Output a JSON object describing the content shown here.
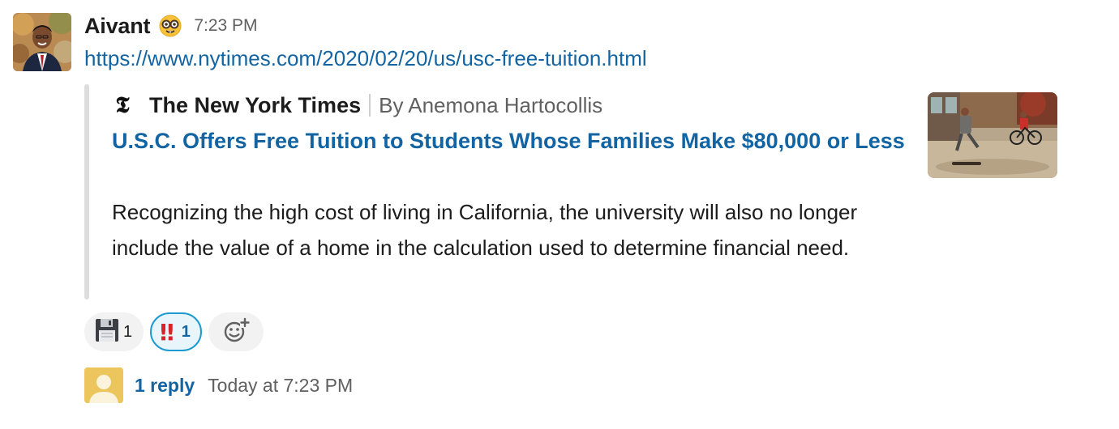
{
  "message": {
    "author": "Aivant",
    "status_emoji": "nerd-face-icon",
    "timestamp": "7:23 PM",
    "link_text": "https://www.nytimes.com/2020/02/20/us/usc-free-tuition.html"
  },
  "attachment": {
    "source_name": "The New York Times",
    "byline": "By Anemona Hartocollis",
    "title": "U.S.C. Offers Free Tuition to Students Whose Families Make $80,000 or Less",
    "description": "Recognizing the high cost of living in California, the university will also no longer include the value of a home in the calculation used to determine financial need.",
    "logo_icon": "nyt-logo-icon",
    "logo_glyph": "𝕿"
  },
  "reactions": [
    {
      "icon": "floppy-disk-icon",
      "count": "1",
      "active": false
    },
    {
      "icon": "double-exclamation-icon",
      "glyph": "‼",
      "count": "1",
      "active": true
    }
  ],
  "add_reaction_icon": "add-reaction-icon",
  "thread": {
    "reply_label": "1 reply",
    "time": "Today at 7:23 PM"
  },
  "colors": {
    "link": "#1264a3",
    "active_reaction_border": "#1d9bd1",
    "thread_avatar": "#ecc55c"
  }
}
